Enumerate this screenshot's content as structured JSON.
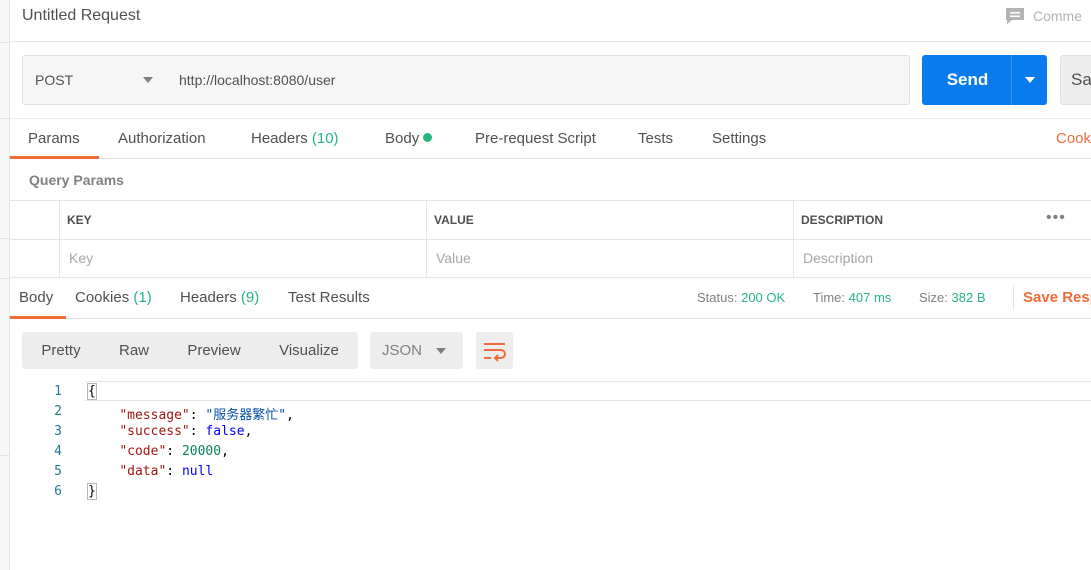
{
  "request": {
    "title": "Untitled Request",
    "comments_label": "Comme",
    "method": "POST",
    "url": "http://localhost:8080/user",
    "send_label": "Send",
    "save_label": "Sa"
  },
  "request_tabs": {
    "params": "Params",
    "authorization": "Authorization",
    "headers": "Headers",
    "headers_count": "(10)",
    "body": "Body",
    "pre_request": "Pre-request Script",
    "tests": "Tests",
    "settings": "Settings",
    "cookies": "Cook"
  },
  "query_params": {
    "section_title": "Query Params",
    "columns": [
      "KEY",
      "VALUE",
      "DESCRIPTION"
    ],
    "placeholders": [
      "Key",
      "Value",
      "Description"
    ],
    "more": "•••"
  },
  "response_tabs": {
    "body": "Body",
    "cookies": "Cookies",
    "cookies_count": "(1)",
    "headers": "Headers",
    "headers_count": "(9)",
    "test_results": "Test Results"
  },
  "response_meta": {
    "status_label": "Status:",
    "status_value": "200 OK",
    "time_label": "Time:",
    "time_value": "407 ms",
    "size_label": "Size:",
    "size_value": "382 B",
    "save_response": "Save Resp"
  },
  "view": {
    "modes": [
      "Pretty",
      "Raw",
      "Preview",
      "Visualize"
    ],
    "active_mode": "Pretty",
    "format": "JSON"
  },
  "code": {
    "line_numbers": [
      "1",
      "2",
      "3",
      "4",
      "5",
      "6"
    ],
    "open_brace": "{",
    "close_brace": "}",
    "key_message": "\"message\"",
    "val_message": "\"服务器繁忙\"",
    "key_success": "\"success\"",
    "val_success": "false",
    "key_code": "\"code\"",
    "val_code": "20000",
    "key_data": "\"data\"",
    "val_data": "null",
    "colon": ": ",
    "comma": ","
  },
  "colors": {
    "accent": "#f26b3a",
    "primary": "#097bed",
    "success": "#26b47f"
  }
}
